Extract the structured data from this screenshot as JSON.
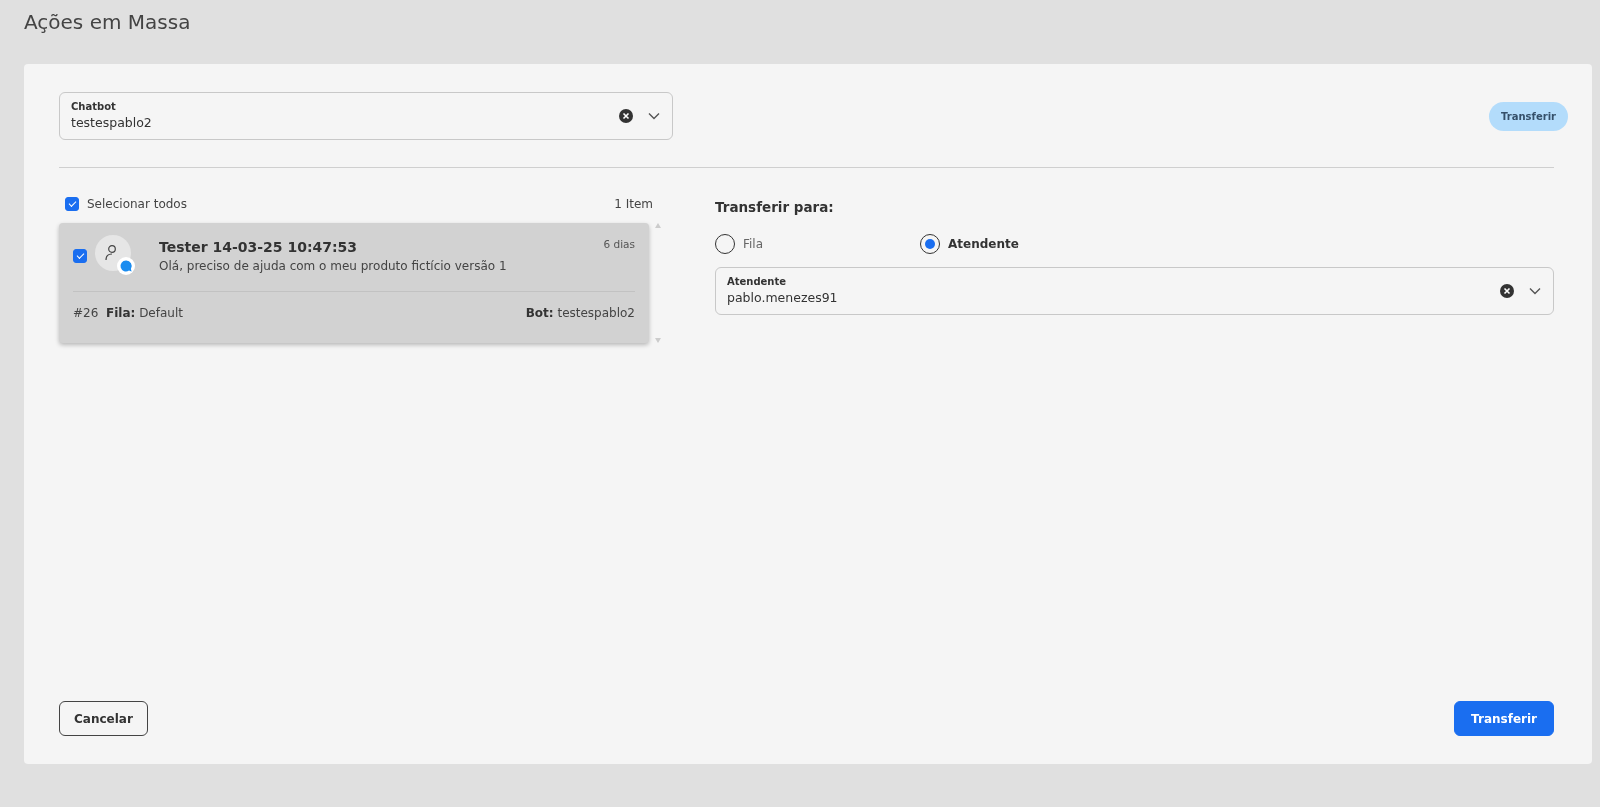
{
  "page_title": "Ações em Massa",
  "chatbot_field": {
    "label": "Chatbot",
    "value": "testespablo2"
  },
  "top_button": {
    "label": "Transferir",
    "disabled": true
  },
  "select_all": {
    "label": "Selecionar todos",
    "checked": true,
    "count": "1 Item"
  },
  "items": [
    {
      "title": "Tester 14-03-25 10:47:53",
      "message": "Olá, preciso de ajuda com o meu produto fictício versão 1",
      "age": "6 dias",
      "number": "#26",
      "queue_label": "Fila:",
      "queue": "Default",
      "bot_label": "Bot:",
      "bot": "testespablo2",
      "checked": true,
      "selected": true
    }
  ],
  "transfer_heading": "Transferir para:",
  "transfer_options": [
    {
      "label": "Fila",
      "selected": false
    },
    {
      "label": "Atendente",
      "selected": true
    }
  ],
  "agent_field": {
    "label": "Atendente",
    "value": "pablo.menezes91"
  },
  "footer": {
    "cancel": "Cancelar",
    "submit": "Transferir"
  }
}
